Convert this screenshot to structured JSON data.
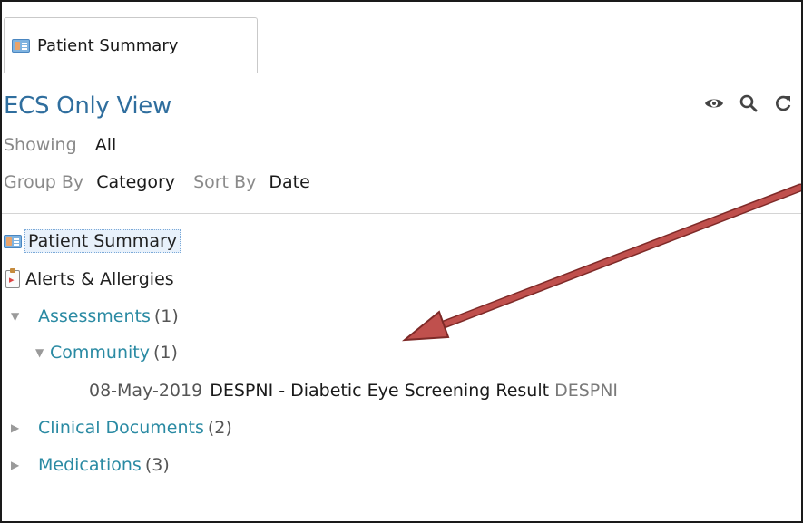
{
  "tab": {
    "label": "Patient Summary",
    "icon": "patient-card-icon"
  },
  "view": {
    "title": "ECS Only View"
  },
  "toolbar": {
    "view_icon": "eye-icon",
    "search_icon": "search-icon",
    "refresh_icon": "refresh-icon"
  },
  "filters": {
    "showing_label": "Showing",
    "showing_value": "All",
    "group_by_label": "Group By",
    "group_by_value": "Category",
    "sort_by_label": "Sort By",
    "sort_by_value": "Date"
  },
  "tree": {
    "patient_summary": "Patient Summary",
    "alerts": "Alerts & Allergies",
    "assessments": {
      "label": "Assessments",
      "count": "(1)"
    },
    "community": {
      "label": "Community",
      "count": "(1)"
    },
    "document": {
      "date": "08-May-2019",
      "title": "DESPNI - Diabetic Eye Screening Result",
      "code": "DESPNI"
    },
    "clinical_documents": {
      "label": "Clinical Documents",
      "count": "(2)"
    },
    "medications": {
      "label": "Medications",
      "count": "(3)"
    }
  },
  "colors": {
    "link": "#2a8aa3",
    "view_title": "#2f6e9e",
    "annotation_arrow": "#c0504d"
  },
  "annotation": {
    "type": "arrow"
  }
}
